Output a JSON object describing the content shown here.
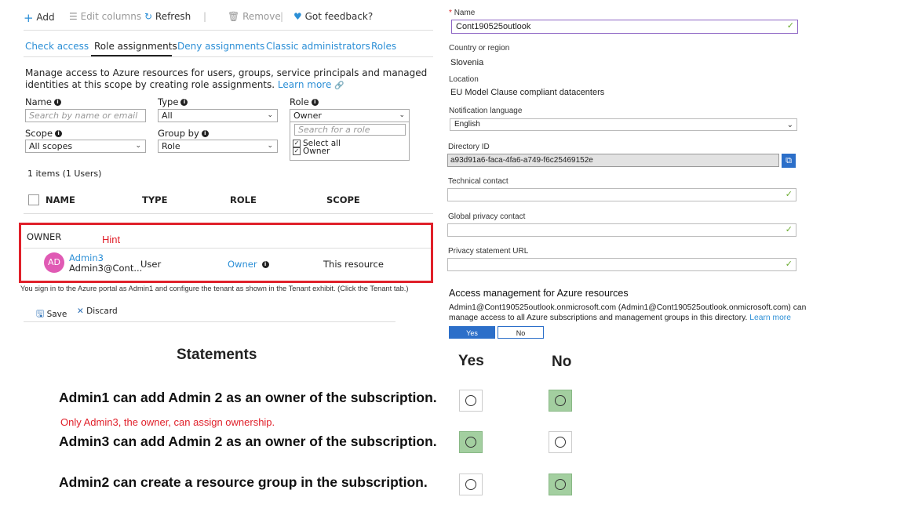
{
  "toolbar": {
    "add": "Add",
    "edit_columns": "Edit columns",
    "refresh": "Refresh",
    "remove": "Remove",
    "feedback": "Got feedback?"
  },
  "tabs": [
    "Check access",
    "Role assignments",
    "Deny assignments",
    "Classic administrators",
    "Roles"
  ],
  "description": {
    "text": "Manage access to Azure resources for users, groups, service principals and managed identities at this scope by creating role assignments.",
    "learn_more": "Learn more"
  },
  "filters": {
    "name_label": "Name",
    "name_placeholder": "Search by name or email",
    "type_label": "Type",
    "type_value": "All",
    "role_label": "Role",
    "role_value": "Owner",
    "role_search_placeholder": "Search for a role",
    "role_options": [
      "Select all",
      "Owner"
    ],
    "scope_label": "Scope",
    "scope_value": "All scopes",
    "groupby_label": "Group by",
    "groupby_value": "Role"
  },
  "table": {
    "count": "1 items (1 Users)",
    "headers": [
      "NAME",
      "TYPE",
      "ROLE",
      "SCOPE"
    ],
    "group": "OWNER",
    "hint": "Hint",
    "row": {
      "initials": "AD",
      "name": "Admin3",
      "email": "Admin3@Cont...",
      "type": "User",
      "role": "Owner",
      "scope": "This resource"
    }
  },
  "caption": "You sign in to the Azure portal as Admin1 and configure the tenant as shown in the Tenant exhibit. (Click the Tenant tab.)",
  "actions": {
    "save": "Save",
    "discard": "Discard"
  },
  "directory": {
    "name_label": "Name",
    "name_required": "*",
    "name_value": "Cont190525outlook",
    "country_label": "Country or region",
    "country_value": "Slovenia",
    "location_label": "Location",
    "location_value": "EU Model Clause compliant datacenters",
    "notif_label": "Notification language",
    "notif_value": "English",
    "dirid_label": "Directory ID",
    "dirid_value": "a93d91a6-faca-4fa6-a749-f6c25469152e",
    "tech_label": "Technical contact",
    "privacy_contact_label": "Global privacy contact",
    "privacy_url_label": "Privacy statement URL",
    "access_title": "Access management for Azure resources",
    "access_text": "Admin1@Cont190525outlook.onmicrosoft.com (Admin1@Cont190525outlook.onmicrosoft.com) can manage access to all Azure subscriptions and management groups in this directory.",
    "access_learn_more": "Learn more",
    "yes": "Yes",
    "no": "No"
  },
  "statements": {
    "title": "Statements",
    "yes_header": "Yes",
    "no_header": "No",
    "items": [
      {
        "text": "Admin1 can add Admin 2 as an owner of the subscription.",
        "answer": "No"
      },
      {
        "text": "Admin3 can add Admin 2 as an owner of the subscription.",
        "answer": "Yes"
      },
      {
        "text": "Admin2 can create a resource group in the subscription.",
        "answer": "No"
      }
    ],
    "note": "Only Admin3, the owner, can assign ownership."
  },
  "colors": {
    "accent": "#2c8fd6",
    "hint_red": "#e0202a",
    "selected_green": "#a3cfa0",
    "avatar": "#e05ab4"
  }
}
